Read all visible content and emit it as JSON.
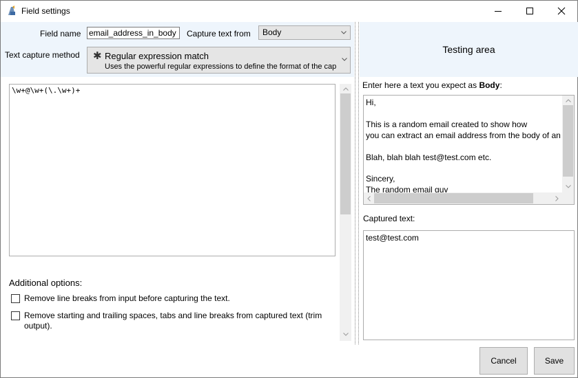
{
  "window": {
    "title": "Field settings"
  },
  "form": {
    "field_name_label": "Field name",
    "field_name_value": "email_address_in_body",
    "capture_from_label": "Capture text from",
    "capture_from_value": "Body",
    "method_label": "Text capture method",
    "method_title": "Regular expression match",
    "method_desc": "Uses the powerful regular expressions to define the format of the cap",
    "regex": "\\w+@\\w+(\\.\\w+)+"
  },
  "options": {
    "heading": "Additional options:",
    "items": [
      {
        "label": "Remove line breaks from input before capturing the text.",
        "checked": false
      },
      {
        "label": "Remove starting and trailing spaces, tabs and line breaks from captured text (trim output).",
        "checked": false
      }
    ]
  },
  "testing": {
    "header": "Testing area",
    "expect_prefix": "Enter here a text you expect as ",
    "expect_bold": "Body",
    "expect_suffix": ":",
    "sample_text": "Hi,\n\nThis is a random email created to show how\nyou can extract an email address from the body of an e\n\nBlah, blah blah test@test.com etc.\n\nSincery,\nThe random email guy",
    "captured_label": "Captured text:",
    "captured_value": "test@test.com"
  },
  "buttons": {
    "cancel": "Cancel",
    "save": "Save"
  }
}
